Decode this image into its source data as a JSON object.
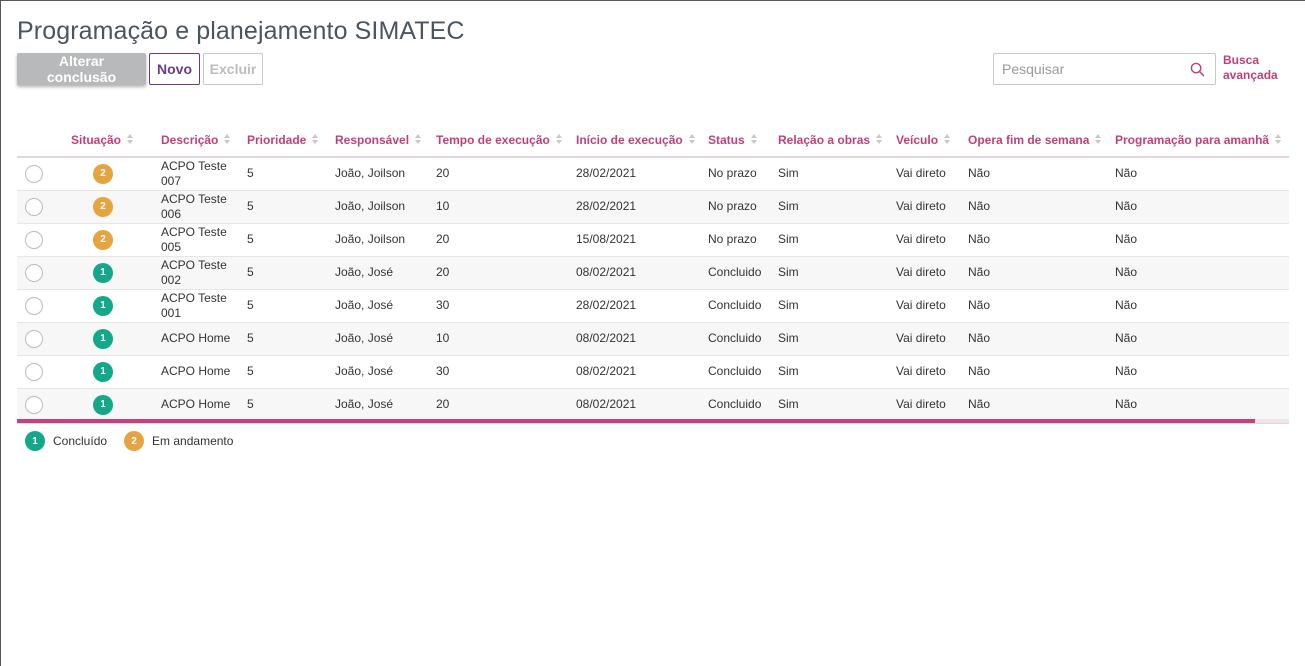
{
  "header": {
    "title": "Programação e planejamento SIMATEC"
  },
  "toolbar": {
    "change_label": "Alterar conclusão",
    "new_label": "Novo",
    "delete_label": "Excluir"
  },
  "search": {
    "placeholder": "Pesquisar",
    "advanced_line1": "Busca",
    "advanced_line2": "avançada"
  },
  "table": {
    "columns": [
      "Situação",
      "Descrição",
      "Prioridade",
      "Responsável",
      "Tempo de execução",
      "Início de execução",
      "Status",
      "Relação a obras",
      "Veículo",
      "Opera fim de semana",
      "Programação para amanhã"
    ],
    "rows": [
      {
        "badge": "2",
        "desc1": "ACPO Teste",
        "desc2": "007",
        "prioridade": "5",
        "responsavel": "João, Joilson",
        "tempo": "20",
        "inicio": "28/02/2021",
        "status": "No prazo",
        "obras": "Sim",
        "veiculo": "Vai direto",
        "fim_semana": "Não",
        "amanha": "Não"
      },
      {
        "badge": "2",
        "desc1": "ACPO Teste",
        "desc2": "006",
        "prioridade": "5",
        "responsavel": "João, Joilson",
        "tempo": "10",
        "inicio": "28/02/2021",
        "status": "No prazo",
        "obras": "Sim",
        "veiculo": "Vai direto",
        "fim_semana": "Não",
        "amanha": "Não"
      },
      {
        "badge": "2",
        "desc1": "ACPO Teste",
        "desc2": "005",
        "prioridade": "5",
        "responsavel": "João, Joilson",
        "tempo": "20",
        "inicio": "15/08/2021",
        "status": "No prazo",
        "obras": "Sim",
        "veiculo": "Vai direto",
        "fim_semana": "Não",
        "amanha": "Não"
      },
      {
        "badge": "1",
        "desc1": "ACPO Teste",
        "desc2": "002",
        "prioridade": "5",
        "responsavel": "João, José",
        "tempo": "20",
        "inicio": "08/02/2021",
        "status": "Concluido",
        "obras": "Sim",
        "veiculo": "Vai direto",
        "fim_semana": "Não",
        "amanha": "Não"
      },
      {
        "badge": "1",
        "desc1": "ACPO Teste",
        "desc2": "001",
        "prioridade": "5",
        "responsavel": "João, José",
        "tempo": "30",
        "inicio": "28/02/2021",
        "status": "Concluido",
        "obras": "Sim",
        "veiculo": "Vai direto",
        "fim_semana": "Não",
        "amanha": "Não"
      },
      {
        "badge": "1",
        "desc1": "ACPO Home",
        "desc2": "",
        "prioridade": "5",
        "responsavel": "João, José",
        "tempo": "10",
        "inicio": "08/02/2021",
        "status": "Concluido",
        "obras": "Sim",
        "veiculo": "Vai direto",
        "fim_semana": "Não",
        "amanha": "Não"
      },
      {
        "badge": "1",
        "desc1": "ACPO Home",
        "desc2": "",
        "prioridade": "5",
        "responsavel": "João, José",
        "tempo": "30",
        "inicio": "08/02/2021",
        "status": "Concluido",
        "obras": "Sim",
        "veiculo": "Vai direto",
        "fim_semana": "Não",
        "amanha": "Não"
      },
      {
        "badge": "1",
        "desc1": "ACPO Home",
        "desc2": "",
        "prioridade": "5",
        "responsavel": "João, José",
        "tempo": "20",
        "inicio": "08/02/2021",
        "status": "Concluido",
        "obras": "Sim",
        "veiculo": "Vai direto",
        "fim_semana": "Não",
        "amanha": "Não"
      }
    ]
  },
  "legend": [
    {
      "badge": "1",
      "label": "Concluído"
    },
    {
      "badge": "2",
      "label": "Em andamento"
    }
  ],
  "colors": {
    "accent": "#c0407a",
    "done": "#13a889",
    "in_progress": "#e6a441",
    "new_button": "#6a3a90"
  },
  "icons": {
    "search": "search-icon",
    "sort": "sort-icon",
    "select": "radio-icon"
  }
}
